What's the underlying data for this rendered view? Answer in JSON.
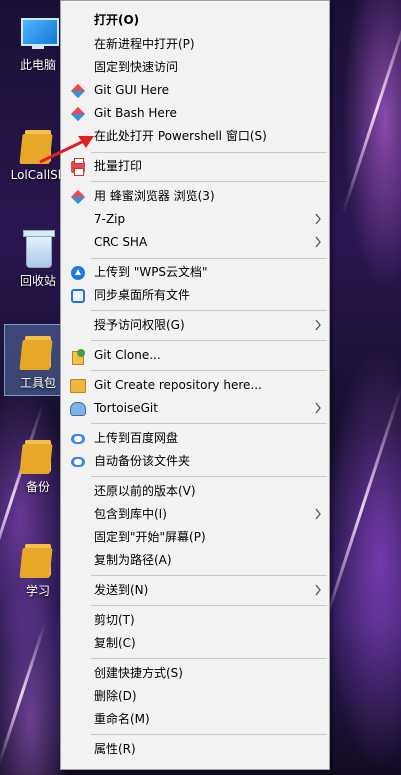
{
  "desktop": {
    "icons": [
      {
        "label": "此电脑",
        "icon": "computer-icon"
      },
      {
        "label": "LolCallSh",
        "icon": "folder-icon"
      },
      {
        "label": "回收站",
        "icon": "recycle-bin-icon"
      },
      {
        "label": "工具包",
        "icon": "qq-folder-icon"
      },
      {
        "label": "备份",
        "icon": "folder-icon"
      },
      {
        "label": "学习",
        "icon": "folder-icon"
      }
    ]
  },
  "menu": {
    "items": [
      {
        "label": "打开(O)",
        "bold": true
      },
      {
        "label": "在新进程中打开(P)"
      },
      {
        "label": "固定到快速访问"
      },
      {
        "label": "Git GUI Here",
        "icon": "git-icon"
      },
      {
        "label": "Git Bash Here",
        "icon": "git-icon"
      },
      {
        "label": "在此处打开 Powershell 窗口(S)"
      },
      {
        "label": "批量打印",
        "icon": "printer-icon"
      },
      {
        "label": "用 蜂蜜浏览器 浏览(3)",
        "icon": "git-icon"
      },
      {
        "label": "7-Zip",
        "submenu": true
      },
      {
        "label": "CRC SHA",
        "submenu": true
      },
      {
        "label": "上传到 \"WPS云文档\"",
        "icon": "cloud-upload-icon"
      },
      {
        "label": "同步桌面所有文件",
        "icon": "sync-icon"
      },
      {
        "label": "授予访问权限(G)",
        "submenu": true
      },
      {
        "label": "Git Clone...",
        "icon": "git-clone-icon"
      },
      {
        "label": "Git Create repository here...",
        "icon": "git-folder-icon"
      },
      {
        "label": "TortoiseGit",
        "icon": "tortoisegit-icon",
        "submenu": true
      },
      {
        "label": "上传到百度网盘",
        "icon": "baidu-netdisk-icon"
      },
      {
        "label": "自动备份该文件夹",
        "icon": "baidu-netdisk-icon"
      },
      {
        "label": "还原以前的版本(V)"
      },
      {
        "label": "包含到库中(I)",
        "submenu": true
      },
      {
        "label": "固定到\"开始\"屏幕(P)"
      },
      {
        "label": "复制为路径(A)"
      },
      {
        "label": "发送到(N)",
        "submenu": true
      },
      {
        "label": "剪切(T)"
      },
      {
        "label": "复制(C)"
      },
      {
        "label": "创建快捷方式(S)"
      },
      {
        "label": "删除(D)"
      },
      {
        "label": "重命名(M)"
      },
      {
        "label": "属性(R)"
      }
    ]
  },
  "colors": {
    "menu_bg": "#f2f2f2",
    "separator": "#c8c8c8",
    "annotation_arrow": "#e02020"
  }
}
